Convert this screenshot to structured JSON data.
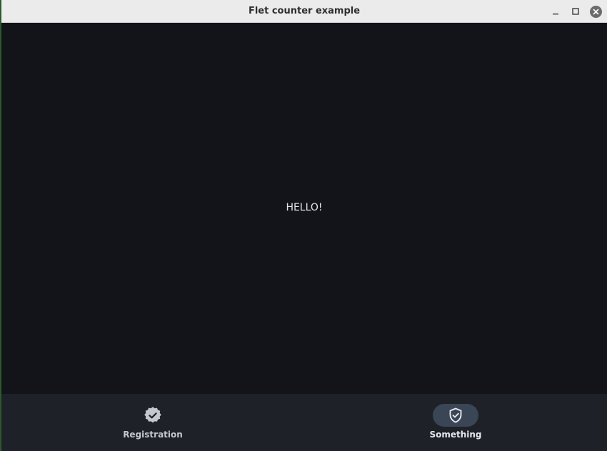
{
  "window": {
    "title": "Flet counter example"
  },
  "main": {
    "text": "HELLO!"
  },
  "navigation": {
    "destinations": [
      {
        "label": "Registration",
        "icon": "verified-badge-icon",
        "selected": false
      },
      {
        "label": "Something",
        "icon": "shield-check-icon",
        "selected": true
      }
    ]
  },
  "colors": {
    "background": "#121419",
    "navbar": "#1e2127",
    "indicator": "#3a4656",
    "titlebar": "#ebebeb"
  }
}
